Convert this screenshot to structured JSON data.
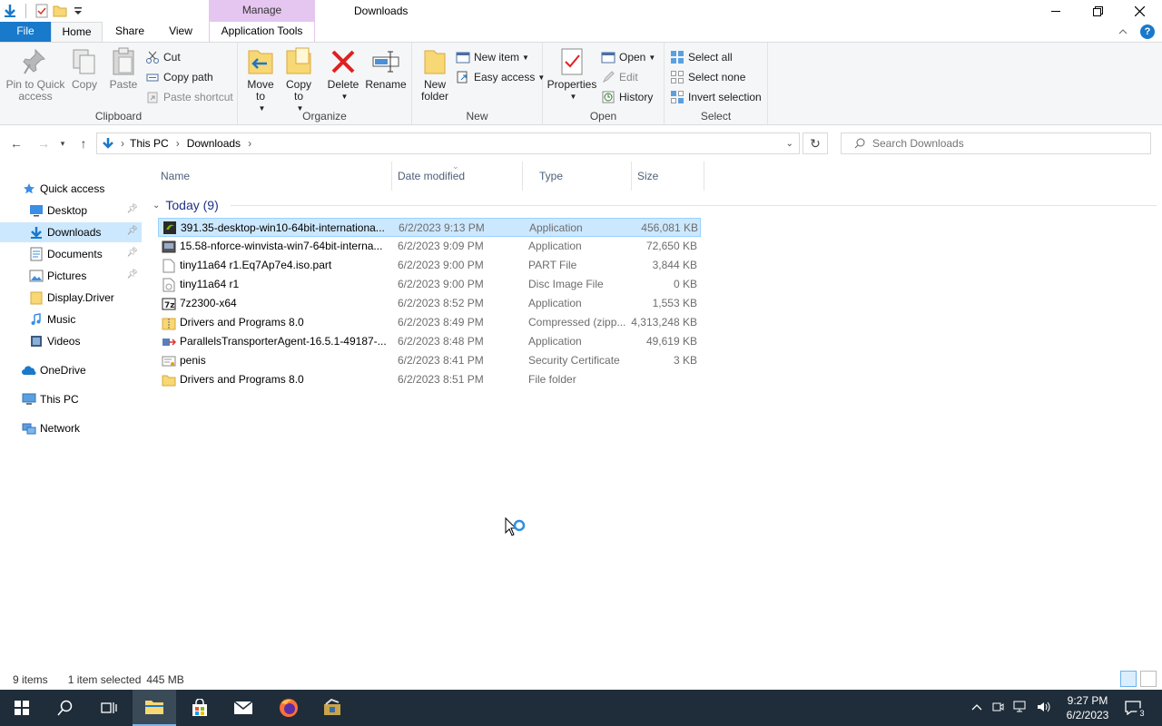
{
  "window": {
    "title": "Downloads",
    "context_tab": "Manage"
  },
  "tabs": {
    "file": "File",
    "home": "Home",
    "share": "Share",
    "view": "View",
    "app_tools": "Application Tools"
  },
  "ribbon": {
    "clipboard": {
      "label": "Clipboard",
      "pin": "Pin to Quick access",
      "copy": "Copy",
      "paste": "Paste",
      "cut": "Cut",
      "copy_path": "Copy path",
      "paste_shortcut": "Paste shortcut"
    },
    "organize": {
      "label": "Organize",
      "move_to": "Move to",
      "copy_to": "Copy to",
      "delete": "Delete",
      "rename": "Rename"
    },
    "new": {
      "label": "New",
      "new_folder": "New folder",
      "new_item": "New item",
      "easy_access": "Easy access"
    },
    "open": {
      "label": "Open",
      "properties": "Properties",
      "open": "Open",
      "edit": "Edit",
      "history": "History"
    },
    "select": {
      "label": "Select",
      "select_all": "Select all",
      "select_none": "Select none",
      "invert": "Invert selection"
    }
  },
  "address": {
    "crumbs": [
      "This PC",
      "Downloads"
    ],
    "search_placeholder": "Search Downloads"
  },
  "nav": {
    "quick_access": "Quick access",
    "desktop": "Desktop",
    "downloads": "Downloads",
    "documents": "Documents",
    "pictures": "Pictures",
    "display_driver": "Display.Driver",
    "music": "Music",
    "videos": "Videos",
    "onedrive": "OneDrive",
    "this_pc": "This PC",
    "network": "Network"
  },
  "columns": {
    "name": "Name",
    "date": "Date modified",
    "type": "Type",
    "size": "Size"
  },
  "group": "Today (9)",
  "files": [
    {
      "name": "391.35-desktop-win10-64bit-internationa...",
      "date": "6/2/2023 9:13 PM",
      "type": "Application",
      "size": "456,081 KB"
    },
    {
      "name": "15.58-nforce-winvista-win7-64bit-interna...",
      "date": "6/2/2023 9:09 PM",
      "type": "Application",
      "size": "72,650 KB"
    },
    {
      "name": "tiny11a64 r1.Eq7Ap7e4.iso.part",
      "date": "6/2/2023 9:00 PM",
      "type": "PART File",
      "size": "3,844 KB"
    },
    {
      "name": "tiny11a64 r1",
      "date": "6/2/2023 9:00 PM",
      "type": "Disc Image File",
      "size": "0 KB"
    },
    {
      "name": "7z2300-x64",
      "date": "6/2/2023 8:52 PM",
      "type": "Application",
      "size": "1,553 KB"
    },
    {
      "name": "Drivers and Programs 8.0",
      "date": "6/2/2023 8:49 PM",
      "type": "Compressed (zipp...",
      "size": "4,313,248 KB"
    },
    {
      "name": "ParallelsTransporterAgent-16.5.1-49187-...",
      "date": "6/2/2023 8:48 PM",
      "type": "Application",
      "size": "49,619 KB"
    },
    {
      "name": "penis",
      "date": "6/2/2023 8:41 PM",
      "type": "Security Certificate",
      "size": "3 KB"
    },
    {
      "name": "Drivers and Programs 8.0",
      "date": "6/2/2023 8:51 PM",
      "type": "File folder",
      "size": ""
    }
  ],
  "status": {
    "count": "9 items",
    "selected": "1 item selected",
    "selected_size": "445 MB"
  },
  "taskbar": {
    "time": "9:27 PM",
    "date": "6/2/2023",
    "notifications": "3"
  },
  "colors": {
    "accent": "#1979ca",
    "selection": "#cce8ff",
    "context_tab": "#e5c6f0",
    "taskbar": "#1f2d3a"
  }
}
